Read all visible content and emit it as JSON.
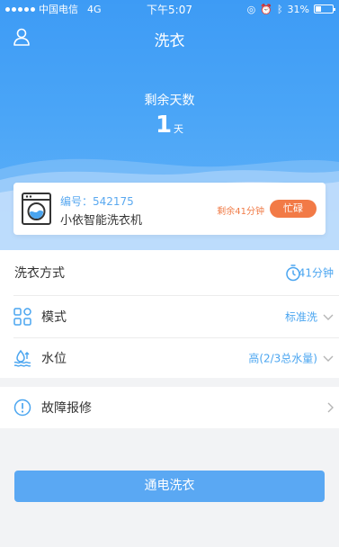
{
  "status_bar": {
    "carrier": "中国电信",
    "network": "4G",
    "time": "下午5:07",
    "battery": "31%",
    "battery_level": 0.31
  },
  "header": {
    "title": "洗衣",
    "remaining_label": "剩余天数",
    "remaining_value": "1",
    "remaining_unit": "天"
  },
  "machine": {
    "number_label": "编号：542175",
    "name": "小依智能洗衣机",
    "time_left": "剩余41分钟",
    "status": "忙碌"
  },
  "wash_method": {
    "label": "洗衣方式",
    "duration": "41分钟"
  },
  "options": [
    {
      "label": "模式",
      "value": "标准洗",
      "icon": "grid-icon"
    },
    {
      "label": "水位",
      "value": "高(2/3总水量)",
      "icon": "water-level-icon"
    }
  ],
  "repair": {
    "label": "故障报修",
    "icon": "alert-circle-icon"
  },
  "action": {
    "label": "通电洗衣"
  },
  "colors": {
    "primary": "#4aa5f7",
    "accent": "#f27a46"
  }
}
